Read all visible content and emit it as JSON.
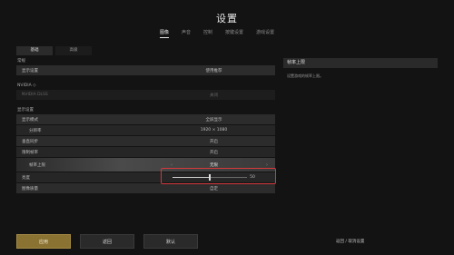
{
  "window": {
    "title": "设置"
  },
  "tabs": [
    {
      "label": "图像",
      "active": true
    },
    {
      "label": "声音",
      "active": false
    },
    {
      "label": "控制",
      "active": false
    },
    {
      "label": "按键设置",
      "active": false
    },
    {
      "label": "游戏设置",
      "active": false
    }
  ],
  "subtabs": [
    {
      "label": "基础",
      "active": true
    },
    {
      "label": "高级",
      "active": false
    }
  ],
  "sections": {
    "general": {
      "label": "常规"
    },
    "nvidia": {
      "label": "NVIDIA ◇"
    },
    "display": {
      "label": "显示设置"
    }
  },
  "general_rows": [
    {
      "label": "显示设置",
      "value": "使用推荐"
    }
  ],
  "nvidia_rows": [
    {
      "label": "NVIDIA DLSS",
      "value": "关闭"
    }
  ],
  "display_rows": [
    {
      "label": "显示模式",
      "value": "全屏显示"
    },
    {
      "label": "分辨率",
      "value": "1920 × 1080"
    },
    {
      "label": "垂直同步",
      "value": "开启"
    },
    {
      "label": "限制帧率",
      "value": "开启"
    }
  ],
  "highlight_row": {
    "label": "帧率上限",
    "value": "无限"
  },
  "brightness_row": {
    "label": "亮度",
    "value": "50",
    "fraction": 0.5
  },
  "last_row": {
    "label": "图像质量",
    "value": "自定"
  },
  "info_panel": {
    "heading": "帧率上限",
    "description": "设置游戏的帧率上限。"
  },
  "buttons": {
    "apply": "应用",
    "back": "返回",
    "reset": "默认"
  },
  "bottom_hint": "返回 / 取消设置",
  "colors": {
    "background": "#131313",
    "accent": "#8a7233",
    "highlight_border": "#d4383c"
  }
}
